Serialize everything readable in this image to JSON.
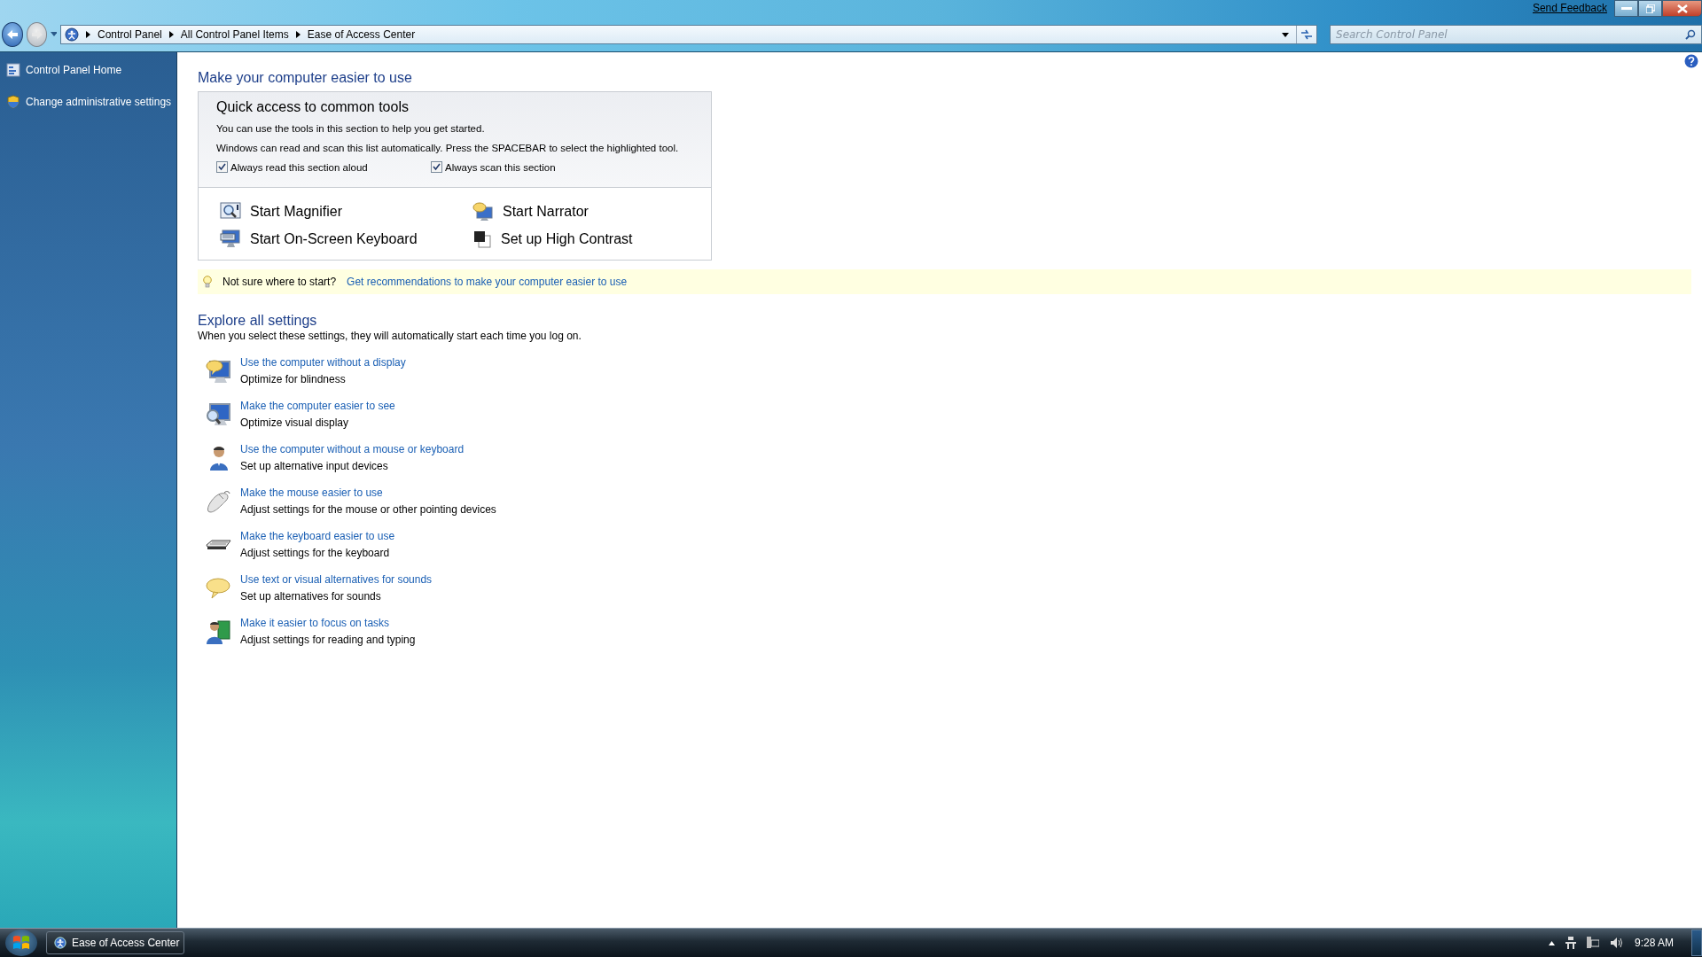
{
  "window": {
    "feedback_link": "Send Feedback"
  },
  "address_bar": {
    "breadcrumbs": [
      "Control Panel",
      "All Control Panel Items",
      "Ease of Access Center"
    ]
  },
  "search": {
    "placeholder": "Search Control Panel"
  },
  "sidebar": {
    "items": [
      {
        "label": "Control Panel Home",
        "kind": "panel"
      },
      {
        "label": "Change administrative settings",
        "kind": "shield"
      }
    ]
  },
  "page": {
    "title": "Make your computer easier to use"
  },
  "quick_access": {
    "title": "Quick access to common tools",
    "lines": [
      "You can use the tools in this section to help you get started.",
      "Windows can read and scan this list automatically.  Press the SPACEBAR to select the highlighted tool."
    ],
    "options": [
      {
        "label": "Always read this section aloud",
        "checked": true
      },
      {
        "label": "Always scan this section",
        "checked": true
      }
    ],
    "tools": [
      {
        "label": "Start Magnifier",
        "kind": "magnifier"
      },
      {
        "label": "Start Narrator",
        "kind": "narrator"
      },
      {
        "label": "Start On-Screen Keyboard",
        "kind": "keyboard"
      },
      {
        "label": "Set up High Contrast",
        "kind": "contrast"
      }
    ]
  },
  "tip": {
    "text": "Not sure where to start?",
    "link": "Get recommendations to make your computer easier to use"
  },
  "explore": {
    "title": "Explore all settings",
    "description": "When you select these settings, they will automatically start each time you log on.",
    "items": [
      {
        "link": "Use the computer without a display",
        "description": "Optimize for blindness",
        "kind": "display"
      },
      {
        "link": "Make the computer easier to see",
        "description": "Optimize visual display",
        "kind": "see"
      },
      {
        "link": "Use the computer without a mouse or keyboard",
        "description": "Set up alternative input devices",
        "kind": "person"
      },
      {
        "link": "Make the mouse easier to use",
        "description": "Adjust settings for the mouse or other pointing devices",
        "kind": "mouse"
      },
      {
        "link": "Make the keyboard easier to use",
        "description": "Adjust settings for the keyboard",
        "kind": "keyboard"
      },
      {
        "link": "Use text or visual alternatives for sounds",
        "description": "Set up alternatives for sounds",
        "kind": "bubble"
      },
      {
        "link": "Make it easier to focus on tasks",
        "description": "Adjust settings for reading and typing",
        "kind": "focus"
      }
    ]
  },
  "taskbar": {
    "tasks": [
      {
        "label": "Ease of Access Center"
      }
    ],
    "clock": "9:28 AM"
  }
}
